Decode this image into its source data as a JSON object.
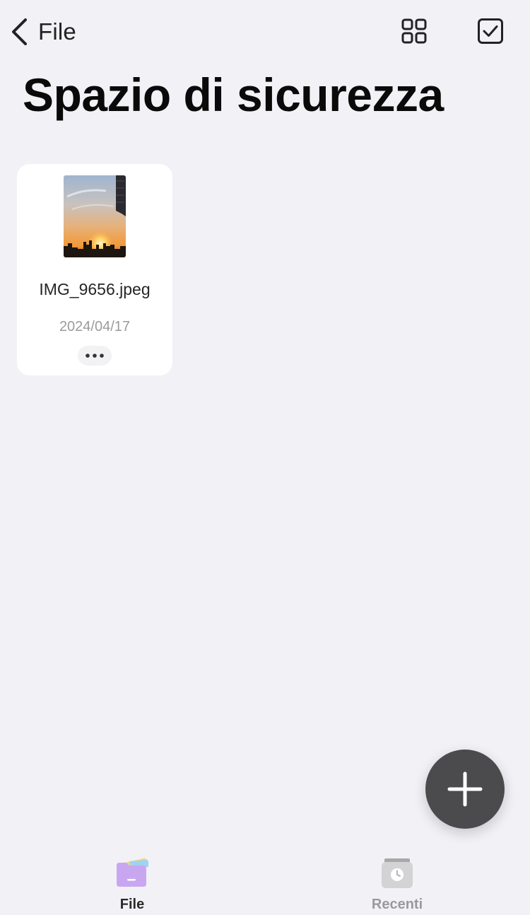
{
  "nav": {
    "back_label": "File",
    "grid_view_icon": "grid-view-icon",
    "select_icon": "checkbox-select-icon"
  },
  "page": {
    "title": "Spazio di sicurezza"
  },
  "files": [
    {
      "name": "IMG_9656.jpeg",
      "date": "2024/04/17",
      "thumbnail": "sunset-photo",
      "more_icon": "more-dots-icon"
    }
  ],
  "fab": {
    "icon": "plus-icon"
  },
  "tabbar": {
    "items": [
      {
        "label": "File",
        "icon": "folder-icon",
        "active": true
      },
      {
        "label": "Recenti",
        "icon": "recent-clock-icon",
        "active": false
      }
    ]
  },
  "colors": {
    "background": "#f2f1f6",
    "card": "#ffffff",
    "fab": "#4b4b4d",
    "folder_accent": "#c9a7f0",
    "inactive_tab": "#9a9a9a"
  }
}
